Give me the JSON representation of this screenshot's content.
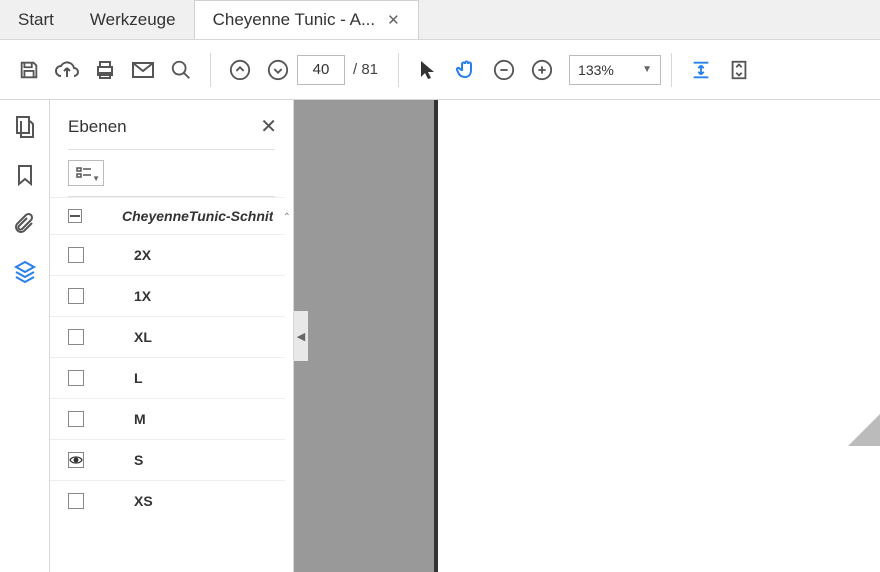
{
  "tabs": {
    "start": "Start",
    "tools": "Werkzeuge",
    "doc": "Cheyenne Tunic - A..."
  },
  "page": {
    "current": "40",
    "total": "81"
  },
  "zoom": "133%",
  "panel": {
    "title": "Ebenen"
  },
  "group": {
    "label": "CheyenneTunic-Schnit"
  },
  "layers": [
    {
      "label": "2X",
      "visible": false
    },
    {
      "label": "1X",
      "visible": false
    },
    {
      "label": "XL",
      "visible": false
    },
    {
      "label": "L",
      "visible": false
    },
    {
      "label": "M",
      "visible": false
    },
    {
      "label": "S",
      "visible": true
    },
    {
      "label": "XS",
      "visible": false
    }
  ]
}
